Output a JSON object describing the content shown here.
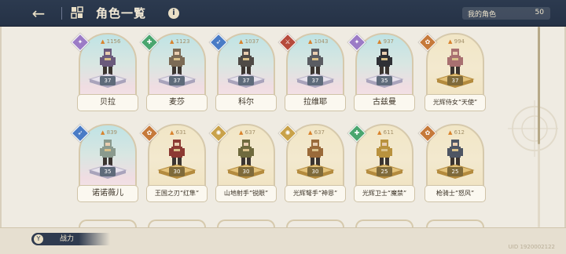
{
  "header": {
    "back_icon": "back-arrow-icon",
    "home_icon": "home-grid-icon",
    "title": "角色一覧",
    "info_icon": "info-icon",
    "info_glyph": "i",
    "count_label": "我的角色",
    "count_value": "50"
  },
  "cards": [
    {
      "name": "贝拉",
      "level": "37",
      "power": "1156",
      "frame": "pastel",
      "class_color": "#9b7bc6",
      "class_icon": "magic-class-icon",
      "class_glyph": "✦",
      "sprite_color": "#6a5a7c"
    },
    {
      "name": "麦莎",
      "level": "37",
      "power": "1123",
      "frame": "pastel",
      "class_color": "#4aa66f",
      "class_icon": "healer-class-icon",
      "class_glyph": "✚",
      "sprite_color": "#7b6a55"
    },
    {
      "name": "科尔",
      "level": "37",
      "power": "1037",
      "frame": "pastel",
      "class_color": "#4a7cc6",
      "class_icon": "archer-class-icon",
      "class_glyph": "➶",
      "sprite_color": "#4f4a46"
    },
    {
      "name": "拉维耶",
      "level": "37",
      "power": "1043",
      "frame": "pastel",
      "class_color": "#b64a3c",
      "class_icon": "warrior-class-icon",
      "class_glyph": "⚔",
      "sprite_color": "#5a5c62"
    },
    {
      "name": "古兹曼",
      "level": "35",
      "power": "937",
      "frame": "pastel",
      "class_color": "#9b7bc6",
      "class_icon": "magic-class-icon",
      "class_glyph": "✦",
      "sprite_color": "#2f3035"
    },
    {
      "name": "光辉侍女“天使”",
      "level": "37",
      "power": "994",
      "frame": "gold",
      "class_color": "#c67a3b",
      "class_icon": "support-class-icon",
      "class_glyph": "✿",
      "sprite_color": "#a87070"
    },
    {
      "name": "诺诺薇儿",
      "level": "35",
      "power": "839",
      "frame": "pastel",
      "class_color": "#4a7cc6",
      "class_icon": "archer-class-icon",
      "class_glyph": "➶",
      "sprite_color": "#8a9a8e"
    },
    {
      "name": "王国之刃“红隼”",
      "level": "30",
      "power": "631",
      "frame": "gold",
      "class_color": "#c67a3b",
      "class_icon": "support-class-icon",
      "class_glyph": "✿",
      "sprite_color": "#8c3a33"
    },
    {
      "name": "山地射手“锐眼”",
      "level": "30",
      "power": "637",
      "frame": "gold",
      "class_color": "#c9a24a",
      "class_icon": "ranger-class-icon",
      "class_glyph": "✺",
      "sprite_color": "#6f6a3e"
    },
    {
      "name": "光辉弩手“神恩”",
      "level": "30",
      "power": "637",
      "frame": "gold",
      "class_color": "#c9a24a",
      "class_icon": "ranger-class-icon",
      "class_glyph": "✺",
      "sprite_color": "#9a6a3a"
    },
    {
      "name": "光辉卫士“魔禁”",
      "level": "25",
      "power": "611",
      "frame": "gold",
      "class_color": "#4aa66f",
      "class_icon": "healer-class-icon",
      "class_glyph": "✚",
      "sprite_color": "#b9923e"
    },
    {
      "name": "枪骑士“怒风”",
      "level": "25",
      "power": "612",
      "frame": "gold",
      "class_color": "#c67a3b",
      "class_icon": "support-class-icon",
      "class_glyph": "✿",
      "sprite_color": "#4e5563"
    }
  ],
  "footer": {
    "sort_icon": "sort-icon",
    "sort_glyph": "Y",
    "sort_label": "战力",
    "uid": "UID 1920002122"
  },
  "colors": {
    "header_bg": "#2c3a4f",
    "page_bg": "#efebe2",
    "flame": "#d9822b"
  }
}
